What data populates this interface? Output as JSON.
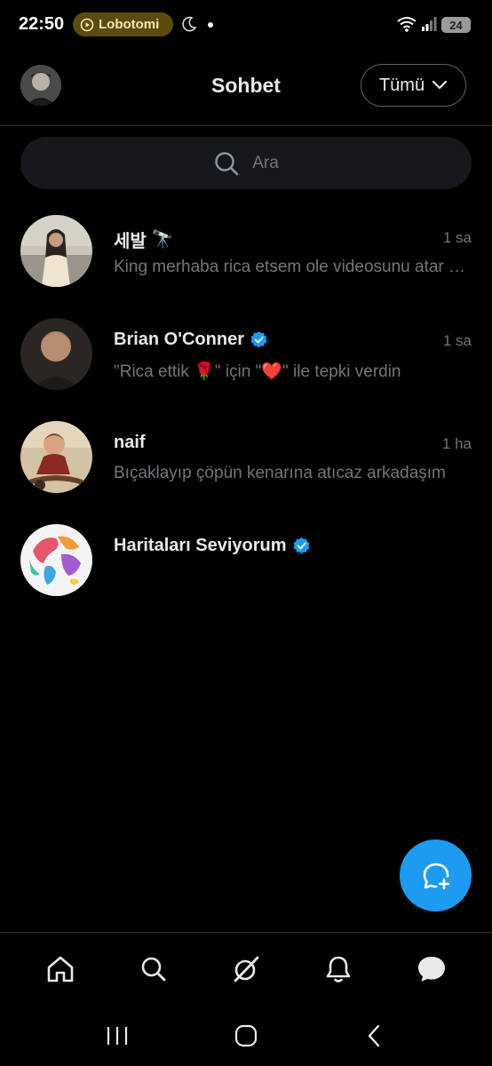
{
  "status_bar": {
    "time": "22:50",
    "media_pill": "Lobotomi",
    "battery": "24"
  },
  "header": {
    "title": "Sohbet",
    "filter_label": "Tümü"
  },
  "search": {
    "placeholder": "Ara"
  },
  "conversations": [
    {
      "name": "세발",
      "emoji": "🔭",
      "time": "1 sa",
      "message": "King merhaba rica etsem ole videosunu atar mısın",
      "verified": false
    },
    {
      "name": "Brian O'Conner",
      "time": "1 sa",
      "message": "\"Rica ettik 🌹\" için \"❤️\" ile tepki verdin",
      "verified": true
    },
    {
      "name": "naif",
      "time": "1 ha",
      "message": "Bıçaklayıp çöpün kenarına atıcaz arkadaşım",
      "verified": false
    },
    {
      "name": "Haritaları Seviyorum",
      "time": "",
      "message": "",
      "verified": true
    }
  ],
  "colors": {
    "accent": "#1d9bf0",
    "background": "#000000",
    "muted": "#71767b",
    "divider": "#2f3336"
  },
  "icons": {
    "nav": [
      "home-icon",
      "search-icon",
      "grok-icon",
      "notifications-icon",
      "messages-icon"
    ],
    "fab": "new-message-icon"
  }
}
